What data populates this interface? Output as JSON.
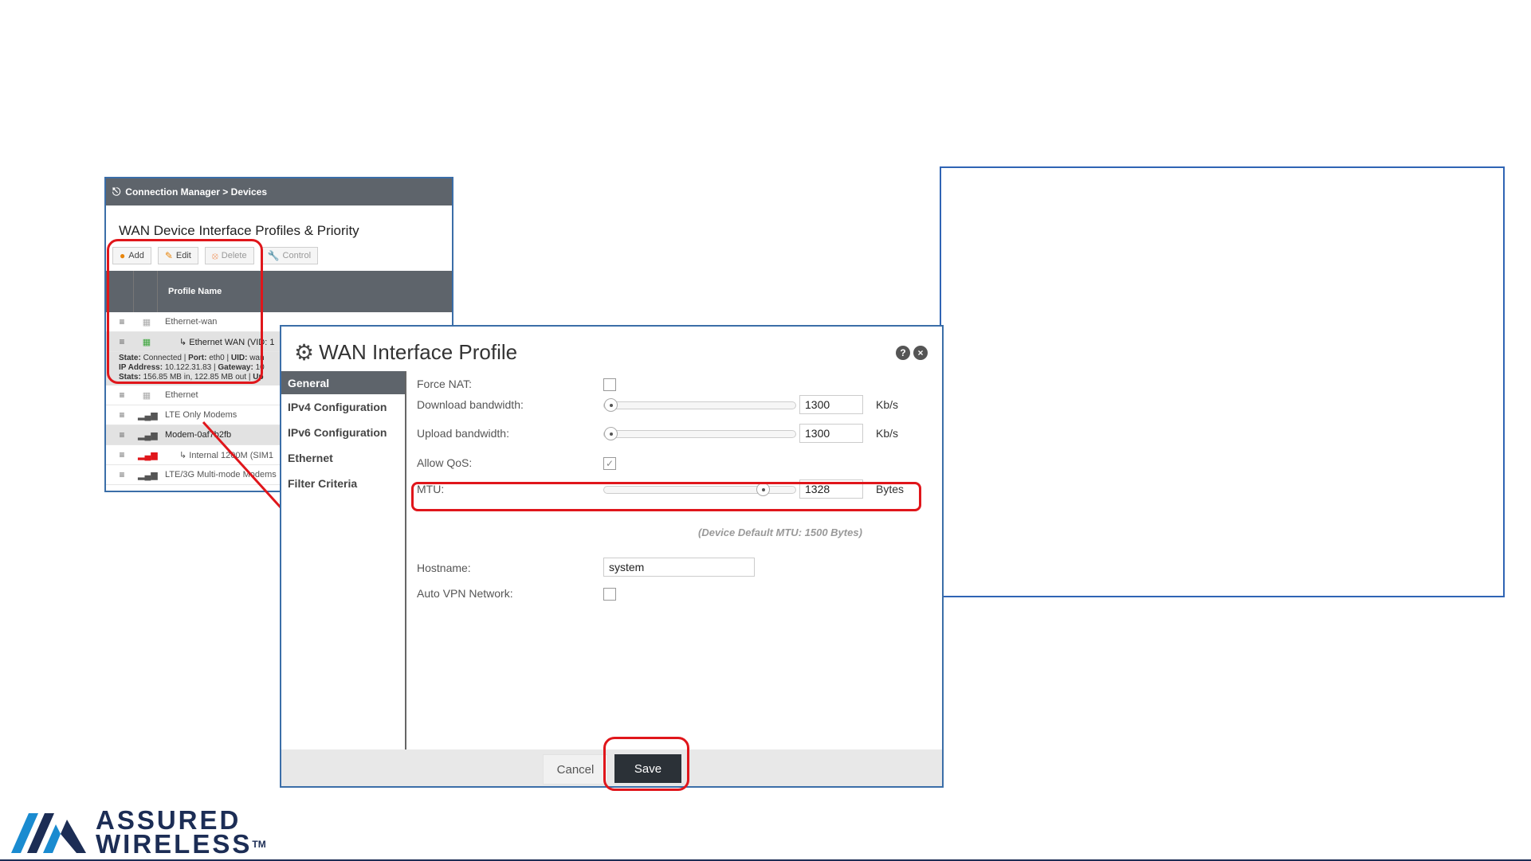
{
  "bg_panel": {
    "breadcrumb": "Connection Manager > Devices",
    "title": "WAN Device Interface Profiles & Priority",
    "toolbar": {
      "add": "Add",
      "edit": "Edit",
      "delete": "Delete",
      "control": "Control"
    },
    "column_header": "Profile Name",
    "rows": [
      {
        "label": "Ethernet-wan"
      },
      {
        "label": "↳ Ethernet WAN (VID: 1"
      },
      {
        "label": "Ethernet"
      },
      {
        "label": "LTE Only Modems"
      },
      {
        "label": "Modem-0af7b2fb"
      },
      {
        "label": "↳ Internal 1200M (SIM1"
      },
      {
        "label": "LTE/3G Multi-mode Modems"
      }
    ],
    "detail": {
      "state_label": "State:",
      "state_value": "Connected",
      "port_label": "Port:",
      "port_value": "eth0",
      "uid_label": "UID:",
      "uid_value": "wan",
      "ip_label": "IP Address:",
      "ip_value": "10.122.31.83",
      "gateway_label": "Gateway:",
      "gateway_value": "10",
      "stats_label": "Stats:",
      "stats_value": "156.85 MB in, 122.85 MB out",
      "up_label": "Up"
    }
  },
  "dialog": {
    "title": "WAN Interface Profile",
    "help_icon": "?",
    "close_icon": "×",
    "nav": [
      "General",
      "IPv4 Configuration",
      "IPv6 Configuration",
      "Ethernet",
      "Filter Criteria"
    ],
    "fields": {
      "force_nat": "Force NAT:",
      "download_bw": "Download bandwidth:",
      "download_value": "1300",
      "download_unit": "Kb/s",
      "download_level": 0.0,
      "upload_bw": "Upload bandwidth:",
      "upload_value": "1300",
      "upload_unit": "Kb/s",
      "upload_level": 0.0,
      "allow_qos": "Allow QoS:",
      "allow_qos_checked": true,
      "mtu": "MTU:",
      "mtu_value": "1328",
      "mtu_unit": "Bytes",
      "mtu_level": 0.85,
      "mtu_note": "(Device Default MTU: 1500 Bytes)",
      "hostname": "Hostname:",
      "hostname_value": "system",
      "auto_vpn": "Auto VPN Network:"
    },
    "footer": {
      "cancel": "Cancel",
      "save": "Save"
    }
  },
  "logo": {
    "line1": "ASSURED",
    "line2": "WIRELESS",
    "tm": "TM"
  },
  "colors": {
    "accent_red": "#e0161b",
    "header_gray": "#5e646b",
    "frame_blue": "#3b6ea8",
    "logo_navy": "#1c2d55"
  }
}
